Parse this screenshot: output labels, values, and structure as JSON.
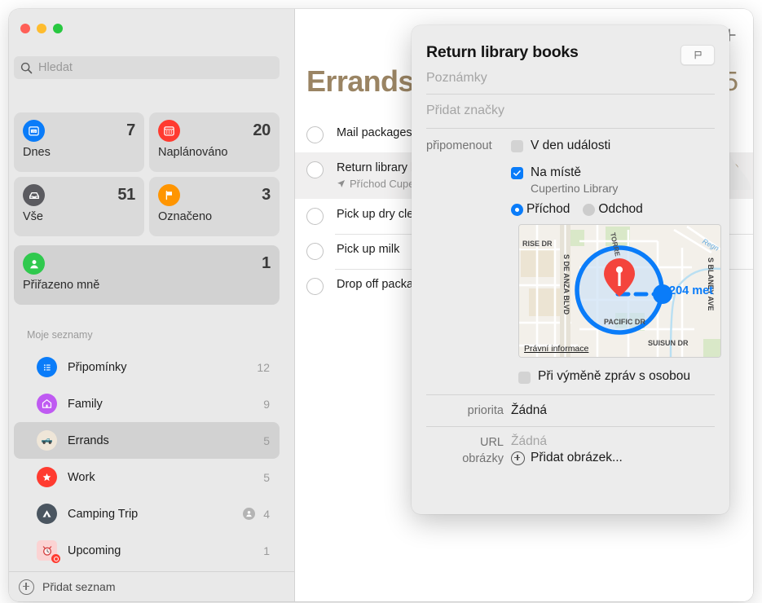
{
  "window": {
    "traffic_lights": [
      "close",
      "minimize",
      "zoom"
    ],
    "colors": {
      "close": "#ff5f57",
      "minimize": "#febc2e",
      "zoom": "#28c840",
      "accent_blue": "#0a7cf9",
      "list_title": "#9a8463"
    }
  },
  "sidebar": {
    "search": {
      "placeholder": "Hledat",
      "value": "",
      "icon": "search-icon"
    },
    "smart_lists": [
      {
        "label": "Dnes",
        "count": "7",
        "icon": "calendar-day-icon",
        "color": "#0a7cf9"
      },
      {
        "label": "Naplánováno",
        "count": "20",
        "icon": "calendar-icon",
        "color": "#ff3b30"
      },
      {
        "label": "Vše",
        "count": "51",
        "icon": "tray-icon",
        "color": "#5b5b60"
      },
      {
        "label": "Označeno",
        "count": "3",
        "icon": "flag-icon",
        "color": "#ff9500"
      }
    ],
    "assigned": {
      "label": "Přiřazeno mně",
      "count": "1",
      "icon": "person-icon",
      "color": "#30c94e"
    },
    "my_lists_header": "Moje seznamy",
    "lists": [
      {
        "name": "Připomínky",
        "count": "12",
        "icon": "list-bullets-icon",
        "color": "#0a7cf9",
        "shared": false,
        "selected": false
      },
      {
        "name": "Family",
        "count": "9",
        "icon": "house-icon",
        "color": "#bf5af2",
        "shared": false,
        "selected": false
      },
      {
        "name": "Errands",
        "count": "5",
        "icon": "truck-emoji-icon",
        "color": "#efe6d8",
        "shared": false,
        "selected": true
      },
      {
        "name": "Work",
        "count": "5",
        "icon": "star-icon",
        "color": "#ff3b30",
        "shared": false,
        "selected": false
      },
      {
        "name": "Camping Trip",
        "count": "4",
        "icon": "tent-icon",
        "color": "#4a5560",
        "shared": true,
        "selected": false
      },
      {
        "name": "Upcoming",
        "count": "1",
        "icon": "alarm-emoji-icon",
        "color": "#fbd3d3",
        "shared": false,
        "selected": false
      }
    ],
    "footer": {
      "add_list_label": "Přidat seznam",
      "icon": "plus-circle-icon"
    }
  },
  "main": {
    "title": "Errands",
    "count": "5",
    "add_button_icon": "plus-icon",
    "info_button_icon": "info-circle-icon",
    "tasks": [
      {
        "title": "Mail packages",
        "subtitle": "",
        "selected": false
      },
      {
        "title": "Return library books",
        "subtitle": "Příchod Cupertino Library",
        "subtitle_icon": "location-arrow-icon",
        "selected": true
      },
      {
        "title": "Pick up dry cleaning",
        "subtitle": "",
        "selected": false
      },
      {
        "title": "Pick up milk",
        "subtitle": "",
        "selected": false
      },
      {
        "title": "Drop off package",
        "subtitle": "",
        "selected": false
      }
    ]
  },
  "popover": {
    "title": "Return library books",
    "flag_button_icon": "flag-outline-icon",
    "notes_placeholder": "Poznámky",
    "tags_placeholder": "Přidat značky",
    "remind_label": "připomenout",
    "on_day_checkbox": {
      "label": "V den události",
      "checked": false
    },
    "at_location_checkbox": {
      "label": "Na místě",
      "checked": true
    },
    "location_name": "Cupertino Library",
    "trigger_options": [
      {
        "label": "Příchod",
        "selected": true
      },
      {
        "label": "Odchod",
        "selected": false
      }
    ],
    "map": {
      "legal_link": "Právní informace",
      "distance_label": "204 met",
      "pin_icon": "map-pin-icon",
      "streets": [
        "RISE DR",
        "S DE ANZA BLVD",
        "PACIFIC DR",
        "SUISUN DR",
        "S BLANEY AVE",
        "TORRE AVE",
        "Regn"
      ]
    },
    "messaging_checkbox": {
      "label": "Při výměně zpráv s osobou",
      "checked": false
    },
    "priority": {
      "label": "priorita",
      "value": "Žádná"
    },
    "url": {
      "label": "URL",
      "value": "Žádná"
    },
    "images": {
      "label": "obrázky",
      "action_label": "Přidat obrázek...",
      "icon": "plus-circle-small-icon"
    }
  }
}
